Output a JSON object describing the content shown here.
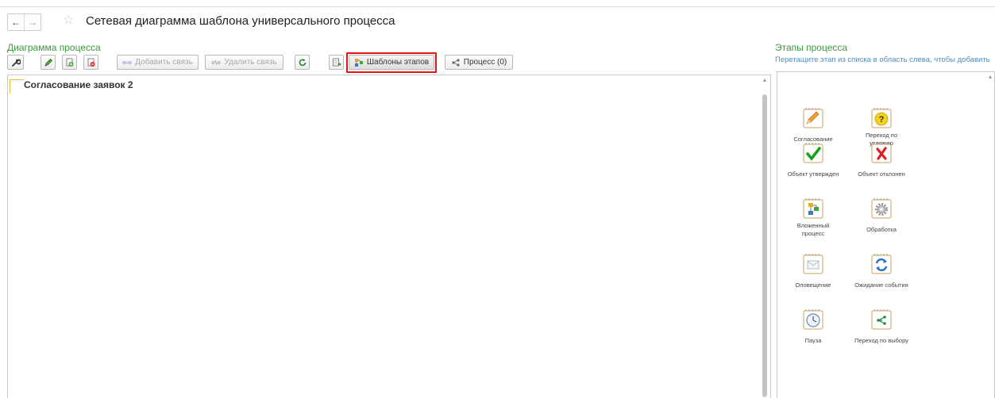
{
  "window": {
    "title": "Сетевая диаграмма шаблона универсального процесса",
    "back_glyph": "←",
    "forward_glyph": "→",
    "star_glyph": "☆"
  },
  "diagram": {
    "section_label": "Диаграмма процесса",
    "toolbar": {
      "add_link_label": "Добавить связь",
      "remove_link_label": "Удалить связь",
      "stage_templates_label": "Шаблоны этапов",
      "process_label": "Процесс (0)"
    },
    "process_name": "Согласование заявок 2"
  },
  "stages": {
    "section_label": "Этапы процесса",
    "hint": "Перетащите этап из списка в область слева, чтобы добавить",
    "items": [
      {
        "label": "Согласование",
        "icon": "pencil-icon"
      },
      {
        "label": "Переход по условию",
        "icon": "question-icon"
      },
      {
        "label": "Объект утвержден",
        "icon": "checkmark-icon"
      },
      {
        "label": "Объект отклонен",
        "icon": "cross-icon"
      },
      {
        "label": "Вложенный процесс",
        "icon": "nested-process-icon"
      },
      {
        "label": "Обработка",
        "icon": "gear-icon"
      },
      {
        "label": "Оповещение",
        "icon": "envelope-icon"
      },
      {
        "label": "Ожидание события",
        "icon": "refresh-icon"
      },
      {
        "label": "Пауза",
        "icon": "clock-icon"
      },
      {
        "label": "Переход по выбору",
        "icon": "branch-icon"
      }
    ]
  },
  "colors": {
    "section_label": "#3b9a3b",
    "hint": "#4a8fc4",
    "highlight": "#e01818",
    "process_marker": "#f0b840"
  }
}
